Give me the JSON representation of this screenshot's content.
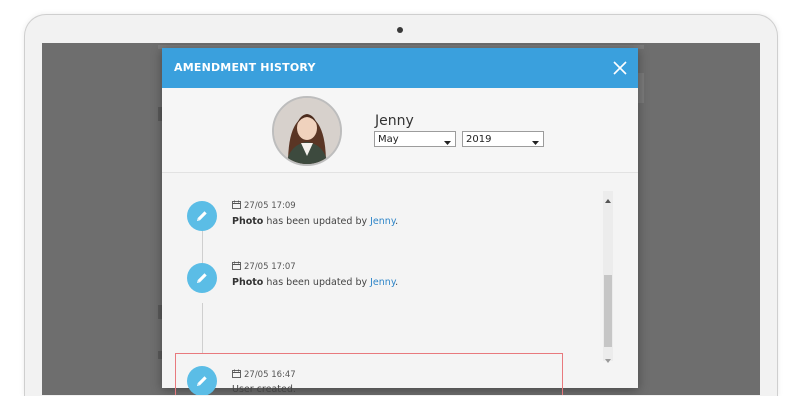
{
  "modal": {
    "title": "AMENDMENT HISTORY",
    "close_icon": "close-icon"
  },
  "profile": {
    "name": "Jenny",
    "month": "May",
    "year": "2019"
  },
  "entries": [
    {
      "date": "27/05 17:09",
      "subject": "Photo",
      "action": " has been updated by ",
      "user": "Jenny",
      "end": "."
    },
    {
      "date": "27/05 17:07",
      "subject": "Photo",
      "action": " has been updated by ",
      "user": "Jenny",
      "end": "."
    },
    {
      "date": "27/05 16:47",
      "text": "User created."
    }
  ],
  "colors": {
    "header": "#3aa0dd",
    "timeline_icon": "#5bbde6",
    "link": "#2f86c9",
    "highlight_border": "#e8797d"
  },
  "icons": {
    "entry_icon": "pencil-icon",
    "date_icon": "calendar-icon"
  }
}
